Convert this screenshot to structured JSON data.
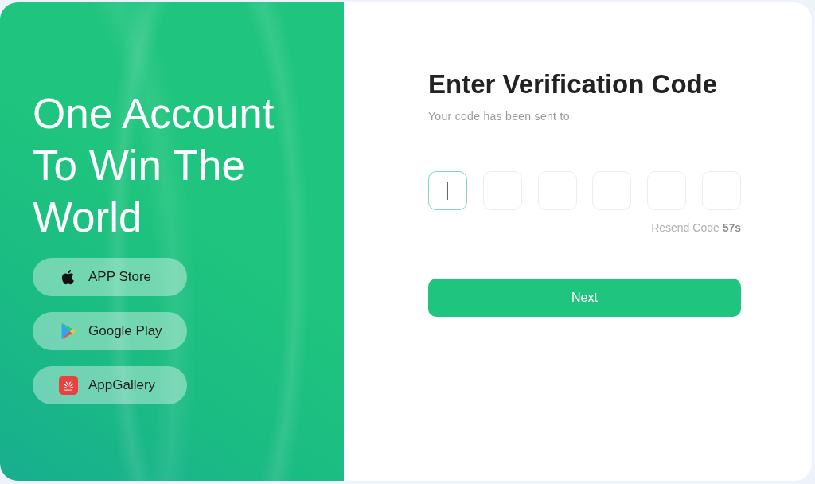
{
  "promo": {
    "headline": "One Account To Win The World",
    "store_buttons": [
      {
        "kind": "apple",
        "label": "APP Store"
      },
      {
        "kind": "google-play",
        "label": "Google Play"
      },
      {
        "kind": "huawei",
        "label": "AppGallery"
      }
    ]
  },
  "verification": {
    "title": "Enter Verification Code",
    "subtitle": "Your code has been sent to",
    "code_fields": [
      {
        "focused": true
      },
      {
        "focused": false
      },
      {
        "focused": false
      },
      {
        "focused": false
      },
      {
        "focused": false
      },
      {
        "focused": false
      }
    ],
    "resend": "Resend Code **57s**",
    "next_button": "Next"
  }
}
